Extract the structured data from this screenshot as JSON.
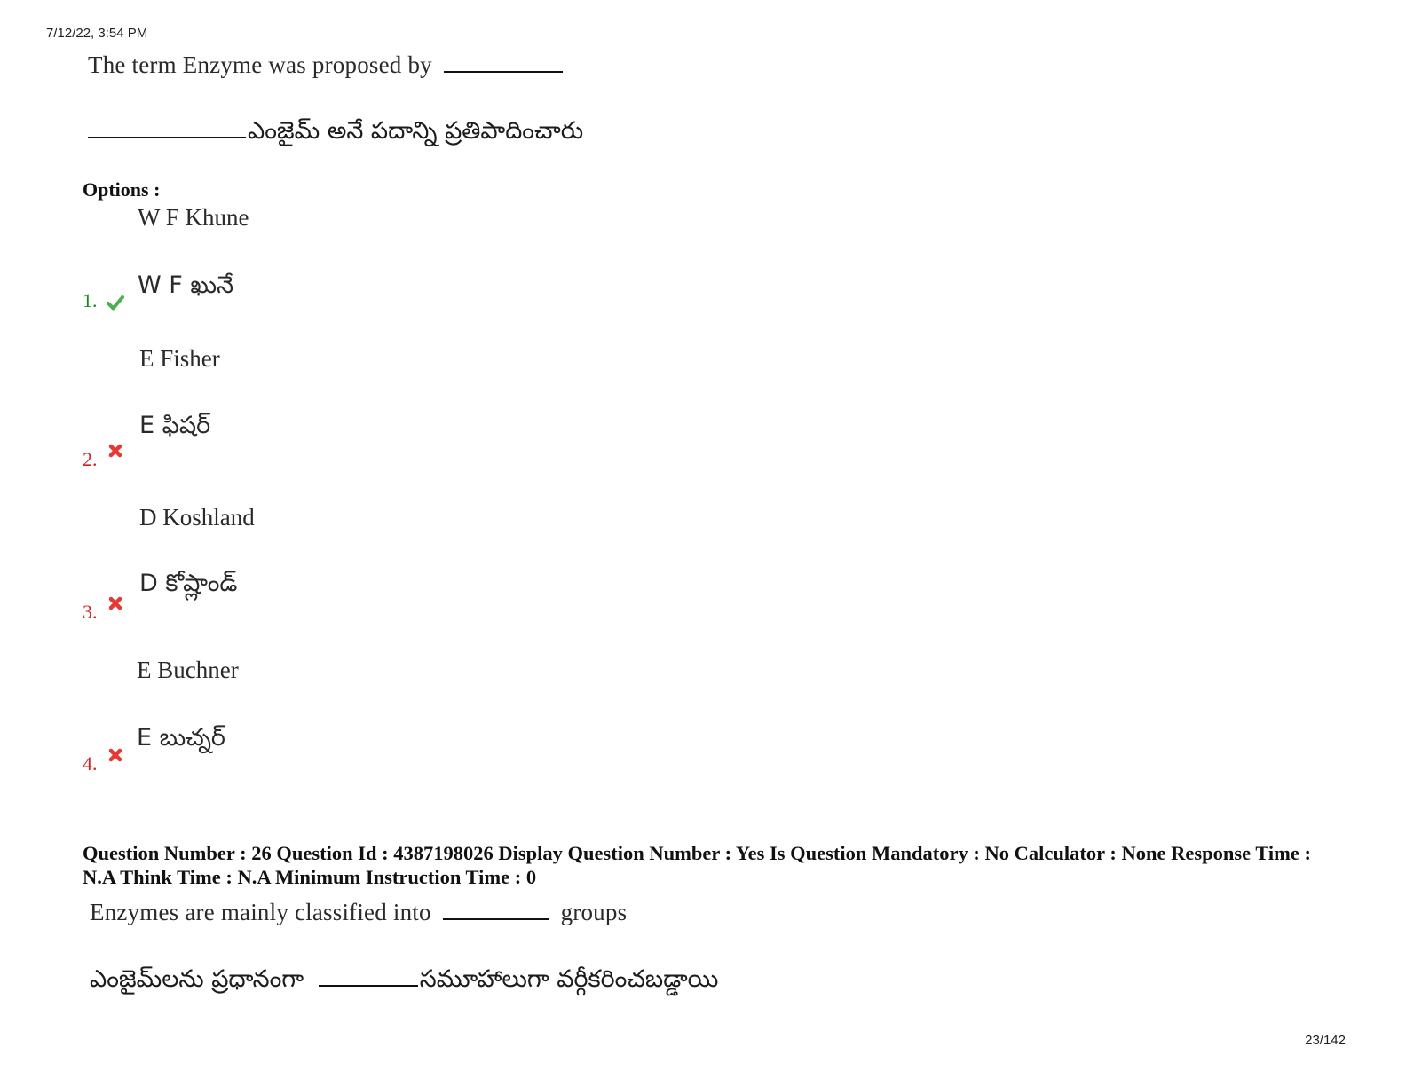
{
  "header": {
    "timestamp": "7/12/22, 3:54 PM"
  },
  "question25": {
    "english": "The term Enzyme was proposed by",
    "telugu": "ఎంజైమ్ అనే పదాన్ని ప్రతిపాదించారు"
  },
  "options_label": "Options :",
  "options": [
    {
      "number": "1.",
      "status": "correct",
      "english": "W F Khune",
      "telugu": "W F ఖునే"
    },
    {
      "number": "2.",
      "status": "wrong",
      "english": "E Fisher",
      "telugu": "E ఫిషర్"
    },
    {
      "number": "3.",
      "status": "wrong",
      "english": "D Koshland",
      "telugu": "D కోష్లాండ్"
    },
    {
      "number": "4.",
      "status": "wrong",
      "english": "E Buchner",
      "telugu": "E బుచ్నర్"
    }
  ],
  "question26": {
    "meta": "Question Number : 26 Question Id : 4387198026 Display Question Number : Yes Is Question Mandatory : No Calculator : None Response Time : N.A Think Time : N.A Minimum Instruction Time : 0",
    "english_before": "Enzymes are mainly classified into",
    "english_after": "groups",
    "telugu_before": "ఎంజైమ్‌లను ప్రధానంగా",
    "telugu_after": "సమూహాలుగా వర్గీకరించబడ్డాయి"
  },
  "footer": {
    "page": "23/142"
  },
  "colors": {
    "correct": "#1a8a1a",
    "wrong": "#d42020"
  }
}
